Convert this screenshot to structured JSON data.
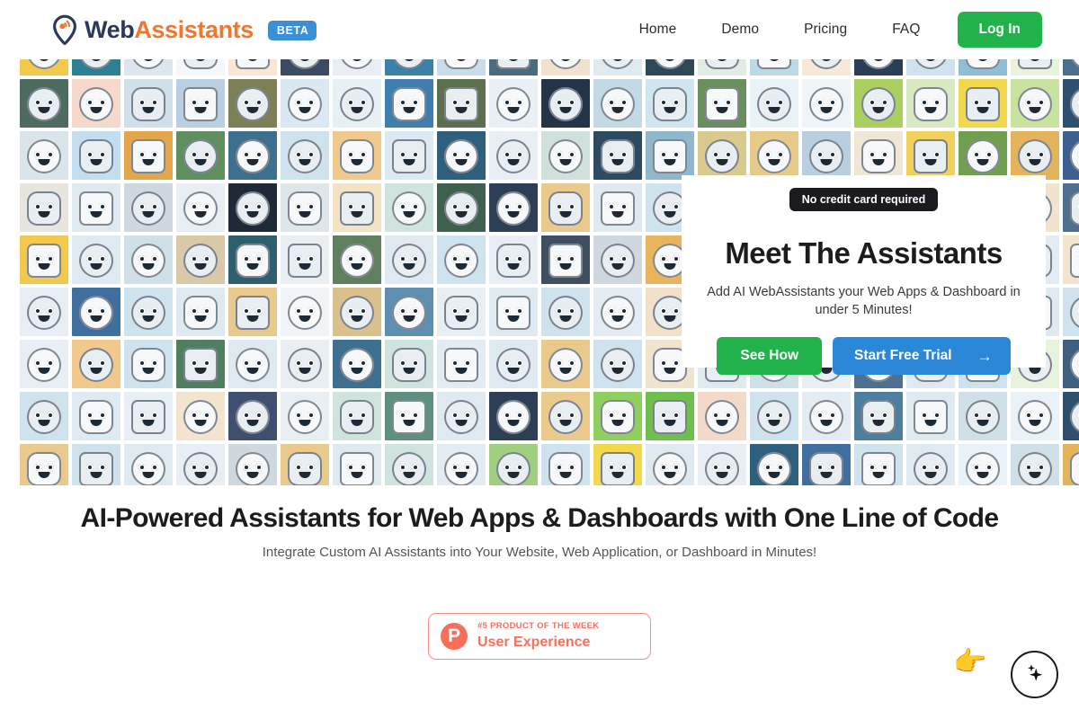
{
  "nav": {
    "logo": {
      "icon": "location-pin-signal-icon",
      "text_primary": "Web",
      "text_accent": "Assistants",
      "badge": "BETA"
    },
    "links": [
      {
        "label": "Home"
      },
      {
        "label": "Demo"
      },
      {
        "label": "Pricing"
      },
      {
        "label": "FAQ"
      }
    ],
    "login_label": "Log In"
  },
  "hero": {
    "pill": "No credit card required",
    "title": "Meet The Assistants",
    "subtitle": "Add AI WebAssistants your Web Apps & Dashboard in under 5 Minutes!",
    "primary_button": "See How",
    "secondary_button": "Start Free Trial",
    "secondary_button_icon": "arrow-right-icon"
  },
  "feature": {
    "title": "AI-Powered Assistants for Web Apps & Dashboards with One Line of Code",
    "subtitle": "Integrate Custom AI Assistants into Your Website, Web Application, or Dashboard in Minutes!"
  },
  "product_hunt": {
    "logo_letter": "P",
    "kicker": "#5 PRODUCT OF THE WEEK",
    "name": "User Experience"
  },
  "chat_widget": {
    "pointer_icon": "pointing-hand-right-emoji",
    "pointer_glyph": "👉",
    "button_icon": "sparkles-icon"
  },
  "colors": {
    "brand_navy": "#2b3a5c",
    "brand_orange": "#f2762e",
    "beta_blue": "#3b8fd4",
    "green": "#22b24c",
    "blue": "#2b87d8",
    "dark_pill": "#1b1b1f",
    "product_hunt": "#f96e5b"
  },
  "avatar_grid": {
    "columns": 21,
    "rows": 10,
    "cell": 54,
    "backgrounds": [
      "#f2c94c",
      "#2d7f94",
      "#dde6ee",
      "#f5f7f9",
      "#fbe6d4",
      "#3c4a63",
      "#e8eef3",
      "#3b82a8",
      "#c9dcea",
      "#4a6b7c",
      "#f0e2cc",
      "#dfe9f0",
      "#2f4858",
      "#e3ece4",
      "#bcd9e8",
      "#f7e9d8",
      "#2a3f55",
      "#cfe3ef",
      "#8fbfd6",
      "#e9f2dc",
      "#4c6f8f",
      "#4e6b5f",
      "#f6d9cb",
      "#cfe0e8",
      "#b9cfe2",
      "#7d7f55",
      "#d9e8f2",
      "#e6f0f5",
      "#3f7fb0",
      "#5c6f4e",
      "#e9eff4",
      "#243447",
      "#c3d9e6",
      "#cfe5f0",
      "#6a8f5f",
      "#e9f2f7",
      "#eef4f8",
      "#a8cf5f",
      "#d8e8c0",
      "#f2d84c",
      "#c8e3a0",
      "#2f4f6f",
      "#d9e5ea",
      "#c3def0",
      "#e3a64a",
      "#5f8f5f",
      "#3f6f8f",
      "#cfe3ef",
      "#f2c98c",
      "#dbe9f2",
      "#2f5f7f",
      "#e8eef3",
      "#cfe0dd",
      "#2d4a63",
      "#8fb8cf",
      "#d9c98c",
      "#e7c98a",
      "#b8cfe2",
      "#efe6d6",
      "#f2d05c",
      "#6f9f4f",
      "#e3b45c",
      "#3f5f8f",
      "#e8e4de",
      "#dfe9f0",
      "#cfd8de",
      "#e9eef2",
      "#1e2a38",
      "#dfe6ea",
      "#f4e2c4",
      "#cfe3df",
      "#3f5f4f",
      "#2d3f55",
      "#e9c98c",
      "#dfe9f0",
      "#cfe3ef",
      "#e7f0db",
      "#4a7f8f",
      "#cfe3ef",
      "#2f4f6f",
      "#dfe9f0",
      "#e9f2dc",
      "#f0e4cf",
      "#4f6f8f",
      "#f2c94c",
      "#dfe9f0",
      "#cfe0e8",
      "#d9c9a8",
      "#2d5f6f",
      "#e9eef2",
      "#5f7f5f",
      "#dfe9f0",
      "#cfe3ef",
      "#e8eef3",
      "#3f4f5f",
      "#cfd8de",
      "#e8b45c",
      "#dfe9f0",
      "#cfe3df",
      "#e9f2f7",
      "#c8e0ef",
      "#dfe9f0",
      "#4f7f9f",
      "#e3ecf2",
      "#f2e4cf",
      "#e8eef3",
      "#3f6f9f",
      "#cfe3ef",
      "#dfe9f0",
      "#e9c98c",
      "#f0f4f7",
      "#d9c08c",
      "#5f8fb0",
      "#e9eef2",
      "#dfe9f0",
      "#cfe3ef",
      "#e3ecf2",
      "#f2e0c8",
      "#cfe3df",
      "#dfe9f0",
      "#3f5f7f",
      "#e9f2f7",
      "#cfe0e8",
      "#2f4f6f",
      "#dfe9f0",
      "#cfe3ef",
      "#e8eef3",
      "#f2c98c",
      "#cfe3ef",
      "#4f7f5f",
      "#dfe9f0",
      "#e9eef2",
      "#3f6f8f",
      "#cfe3df",
      "#e3ecf2",
      "#dfe9f0",
      "#e9c98c",
      "#cfe3ef",
      "#f0e4cf",
      "#dfe9f0",
      "#cfe0e8",
      "#e8eef3",
      "#4f6f8f",
      "#dfe9f0",
      "#cfe3ef",
      "#e9f2dc",
      "#3f5f7f",
      "#cfe3ef",
      "#dfe9f0",
      "#e8eef3",
      "#f2e4cf",
      "#3f4f6f",
      "#e9eef2",
      "#cfe3df",
      "#5f8f7f",
      "#dfe9f0",
      "#2d3f55",
      "#e9c98c",
      "#8fcf5f",
      "#6fbf4f",
      "#f2d9c8",
      "#cfe3ef",
      "#e3ecf2",
      "#4f7f9f",
      "#dfe9f0",
      "#cfe0e8",
      "#e9f2f7",
      "#2f4f6f",
      "#e9c98c",
      "#cfe3ef",
      "#dfe9f0",
      "#e8eef3",
      "#cfd8de",
      "#e9c98c",
      "#dfe9f0",
      "#cfe3df",
      "#e3ecf2",
      "#9fcf7f",
      "#cfe3ef",
      "#f2d84c",
      "#dfe9f0",
      "#e8eef3",
      "#2f5f7f",
      "#3f6f9f",
      "#cfe3ef",
      "#dfe9f0",
      "#e9f2f7",
      "#cfe0e8",
      "#e3b45c",
      "#6f6f4f",
      "#8fd9cf",
      "#dfe9f0",
      "#2b6fd8",
      "#e8eef3",
      "#f0f4f7",
      "#e3b45c",
      "#cfe3ef",
      "#dfe9f0",
      "#e9eef2",
      "#cfe3df",
      "#e3ecf2",
      "#dfe9f0",
      "#cfe0e8",
      "#e8eef3",
      "#f2e4cf",
      "#cfe3ef",
      "#dfe9f0",
      "#e9f2f7",
      "#cfe3ef",
      "#dfe9f0"
    ]
  }
}
